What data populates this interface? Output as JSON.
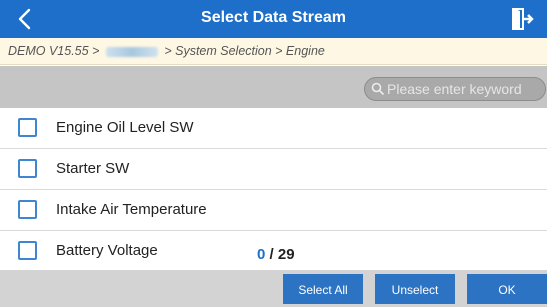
{
  "header": {
    "title": "Select Data Stream",
    "back_icon": "chevron-left-icon",
    "exit_icon": "exit-icon",
    "color": "#1e6fc9"
  },
  "breadcrumb": {
    "prefix": "DEMO V15.55 >",
    "suffix": "> System Selection > Engine"
  },
  "search": {
    "placeholder": "Please enter keyword",
    "icon": "search-icon"
  },
  "items": [
    {
      "label": "Engine Oil Level SW",
      "checked": false
    },
    {
      "label": "Starter SW",
      "checked": false
    },
    {
      "label": "Intake Air Temperature",
      "checked": false
    },
    {
      "label": "Battery Voltage",
      "checked": false
    }
  ],
  "counter": {
    "selected": "0",
    "total": "/ 29"
  },
  "buttons": {
    "select_all": "Select All",
    "unselect": "Unselect",
    "ok": "OK"
  }
}
